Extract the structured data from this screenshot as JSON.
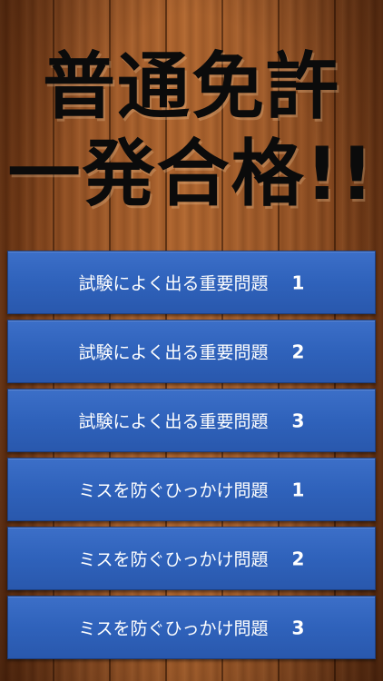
{
  "title": {
    "line1": "普通免許",
    "line2": "一発合格!!"
  },
  "menu": {
    "items": [
      {
        "label": "試験によく出る重要問題",
        "number": "1"
      },
      {
        "label": "試験によく出る重要問題",
        "number": "2"
      },
      {
        "label": "試験によく出る重要問題",
        "number": "3"
      },
      {
        "label": "ミスを防ぐひっかけ問題",
        "number": "1"
      },
      {
        "label": "ミスを防ぐひっかけ問題",
        "number": "2"
      },
      {
        "label": "ミスを防ぐひっかけ問題",
        "number": "3"
      }
    ]
  },
  "colors": {
    "background_wood": "#9a5526",
    "button_blue": "#2f62bb",
    "title_text": "#0b0b0b",
    "button_text": "#ffffff"
  }
}
